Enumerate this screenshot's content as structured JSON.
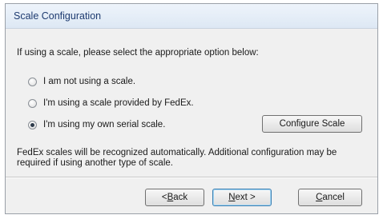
{
  "window": {
    "title": "Scale Configuration"
  },
  "prompt": "If using a scale, please select the appropriate option below:",
  "options": [
    {
      "label": "I am not using a scale.",
      "checked": false
    },
    {
      "label": "I'm using a scale provided by FedEx.",
      "checked": false
    },
    {
      "label": "I'm using my own serial scale.",
      "checked": true
    }
  ],
  "configure_button": "Configure Scale",
  "note": "FedEx scales will be recognized automatically. Additional configuration may be required if using another type of scale.",
  "buttons": {
    "back": {
      "prefix": "<",
      "mnemonic": "B",
      "rest": "ack"
    },
    "next": {
      "mnemonic": "N",
      "rest": "ext >"
    },
    "cancel": {
      "mnemonic": "C",
      "rest": "ancel"
    }
  }
}
